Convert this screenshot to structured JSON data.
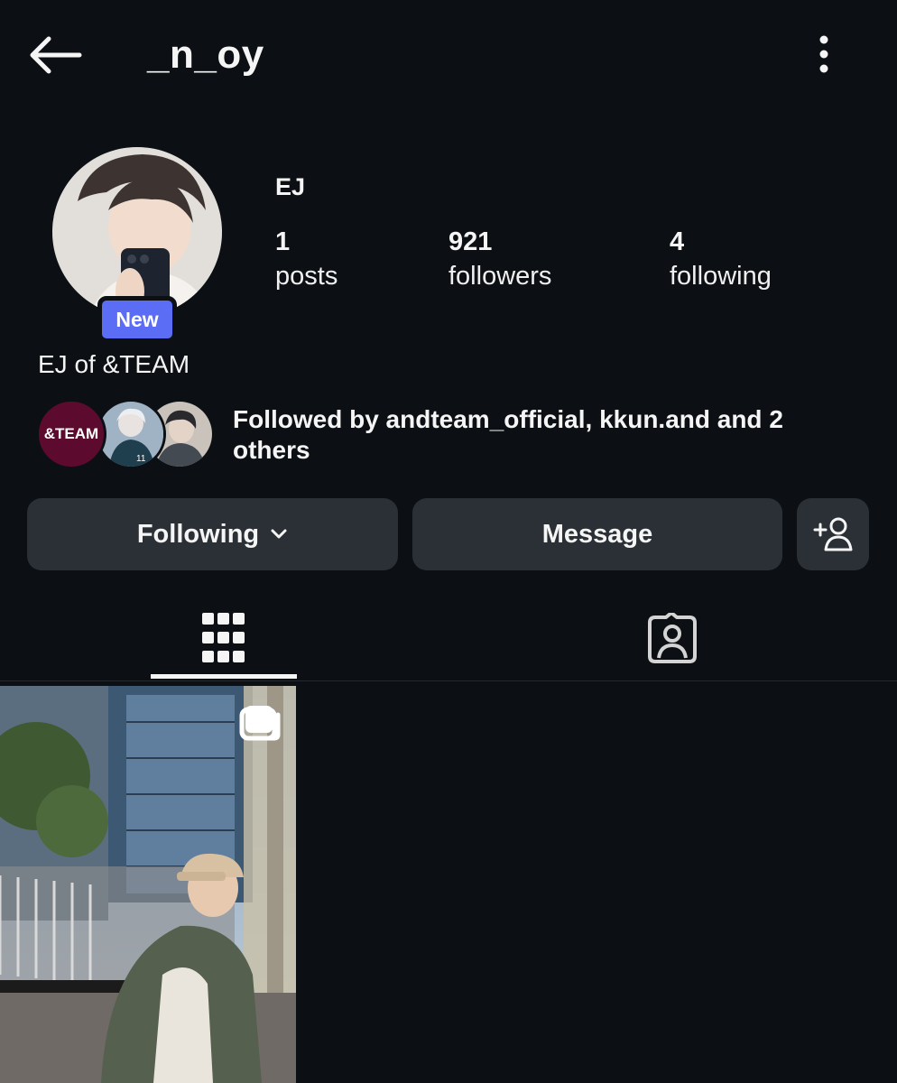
{
  "header": {
    "username": "_n_oy",
    "back_icon": "arrow-left-icon",
    "more_icon": "more-vertical-icon"
  },
  "profile": {
    "new_badge": "New",
    "display_name": "EJ",
    "bio": "EJ of &TEAM",
    "stats": {
      "posts_count": "1",
      "posts_label": "posts",
      "followers_count": "921",
      "followers_label": "followers",
      "following_count": "4",
      "following_label": "following"
    }
  },
  "followed_by": {
    "first_avatar_text": "&TEAM",
    "text": "Followed by andteam_official, kkun.and and 2 others"
  },
  "actions": {
    "following_label": "Following",
    "message_label": "Message",
    "add_user_icon": "add-person-icon"
  },
  "tabs": [
    {
      "icon": "grid-icon",
      "active": true
    },
    {
      "icon": "tagged-icon",
      "active": false
    }
  ],
  "colors": {
    "background": "#0c1014",
    "button": "#2b3036",
    "new_badge": "#5b6cf5",
    "andteam_avatar": "#5c0b2e"
  }
}
